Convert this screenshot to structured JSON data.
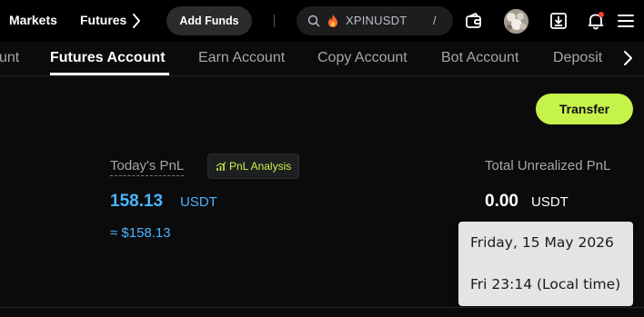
{
  "topbar": {
    "markets_label": "Markets",
    "futures_label": "Futures",
    "add_funds_label": "Add Funds",
    "search": {
      "text": "XPINUSDT",
      "shortcut": "/"
    },
    "icons": [
      "search-icon",
      "flame-icon",
      "wallet-icon",
      "avatar",
      "download-icon",
      "bell-icon",
      "menu-icon"
    ],
    "notification_dot_color": "#ff3b30"
  },
  "tabs": [
    {
      "label": "unt",
      "active": false
    },
    {
      "label": "Futures Account",
      "active": true
    },
    {
      "label": "Earn Account",
      "active": false
    },
    {
      "label": "Copy Account",
      "active": false
    },
    {
      "label": "Bot Account",
      "active": false
    },
    {
      "label": "Deposit",
      "active": false
    }
  ],
  "actions": {
    "transfer_label": "Transfer"
  },
  "pnl": {
    "label": "Today's PnL",
    "analysis_label": "PnL Analysis",
    "value": "158.13",
    "unit": "USDT",
    "approx": "≈ $158.13"
  },
  "unrealized": {
    "label": "Total Unrealized PnL",
    "value": "0.00",
    "unit": "USDT"
  },
  "tooltip": {
    "date_line": "Friday, 15 May 2026",
    "time_line": "Fri 23:14 (Local time)"
  },
  "colors": {
    "accent_green": "#c6f34a",
    "positive_blue": "#4cb3ff",
    "background": "#0b0b0c"
  }
}
